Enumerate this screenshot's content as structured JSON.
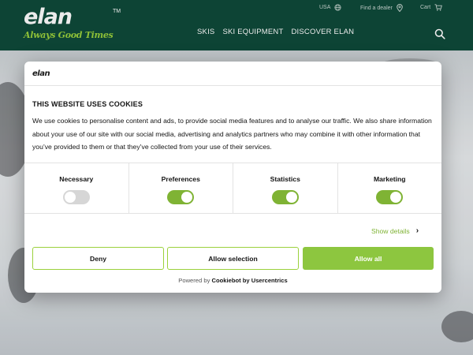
{
  "header": {
    "logo": "elan",
    "tm": "TM",
    "tagline": "Always Good Times",
    "country": "USA",
    "dealer": "Find a dealer",
    "cart": "Cart",
    "nav": [
      "SKIS",
      "SKI EQUIPMENT",
      "DISCOVER ELAN"
    ],
    "icons": [
      "globe-icon",
      "location-pin-icon",
      "cart-icon",
      "search-icon"
    ]
  },
  "cookie_dialog": {
    "logo": "elan",
    "title": "THIS WEBSITE USES COOKIES",
    "body": "We use cookies to personalise content and ads, to provide social media features and to analyse our traffic. We also share information about your use of our site with our social media, advertising and analytics partners who may combine it with other information that you’ve provided to them or that they’ve collected from your use of their services.",
    "categories": [
      {
        "label": "Necessary",
        "enabled": true,
        "locked": true
      },
      {
        "label": "Preferences",
        "enabled": true,
        "locked": false
      },
      {
        "label": "Statistics",
        "enabled": true,
        "locked": false
      },
      {
        "label": "Marketing",
        "enabled": true,
        "locked": false
      }
    ],
    "show_details": "Show details",
    "buttons": {
      "deny": "Deny",
      "selection": "Allow selection",
      "all": "Allow all"
    },
    "powered_prefix": "Powered by",
    "powered_brand": "Cookiebot by Usercentrics"
  },
  "colors": {
    "header_bg": "#0f4a3a",
    "accent_green": "#8dc63f",
    "toggle_on": "#7fb334",
    "toggle_locked": "#d6d6d6"
  }
}
